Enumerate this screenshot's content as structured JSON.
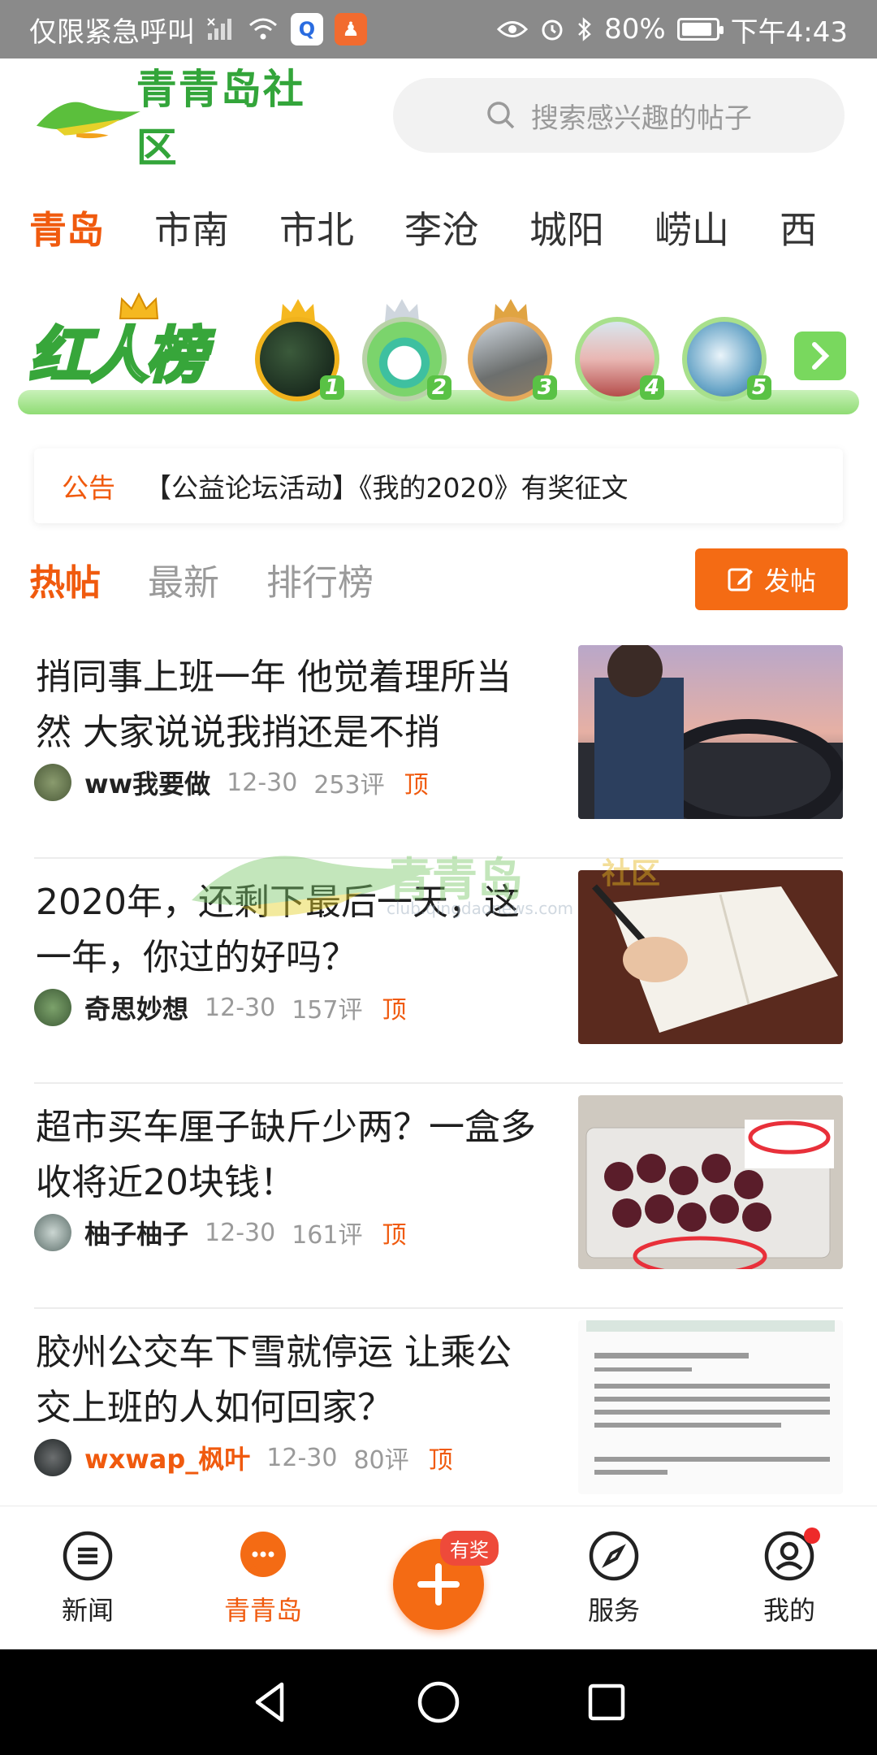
{
  "status_bar": {
    "carrier": "仅限紧急呼叫",
    "battery": "80%",
    "time": "下午4:43"
  },
  "header": {
    "logo_text": "青青岛社区",
    "search_placeholder": "搜索感兴趣的帖子"
  },
  "city_tabs": [
    "青岛",
    "市南",
    "市北",
    "李沧",
    "城阳",
    "崂山",
    "西"
  ],
  "rank_banner": {
    "title": "红人榜",
    "ranks": [
      "1",
      "2",
      "3",
      "4",
      "5"
    ]
  },
  "notice": {
    "tag": "公告",
    "text": "【公益论坛活动】《我的2020》有奖征文"
  },
  "feed_tabs": [
    "热帖",
    "最新",
    "排行榜"
  ],
  "post_button": "发帖",
  "posts": [
    {
      "title": "捎同事上班一年 他觉着理所当然 大家说说我捎还是不捎",
      "author": "ww我要做",
      "date": "12-30",
      "comments": "253评",
      "top": "顶"
    },
    {
      "title": "2020年，还剩下最后一天，这一年，你过的好吗？",
      "author": "奇思妙想",
      "date": "12-30",
      "comments": "157评",
      "top": "顶"
    },
    {
      "title": "超市买车厘子缺斤少两？一盒多收将近20块钱！",
      "author": "柚子柚子",
      "date": "12-30",
      "comments": "161评",
      "top": "顶"
    },
    {
      "title": "胶州公交车下雪就停运 让乘公交上班的人如何回家？",
      "author": "wxwap_枫叶",
      "date": "12-30",
      "comments": "80评",
      "top": "顶"
    }
  ],
  "watermark": {
    "text": "青青岛",
    "suffix": "社区",
    "url": "club.qingdaonews.com"
  },
  "bottom_nav": {
    "news": "新闻",
    "qingqingdao": "青青岛",
    "fab_badge": "有奖",
    "service": "服务",
    "mine": "我的"
  },
  "colors": {
    "accent": "#f05a0e",
    "brand_green": "#33a53a",
    "status_bar": "#8a8a8a"
  }
}
